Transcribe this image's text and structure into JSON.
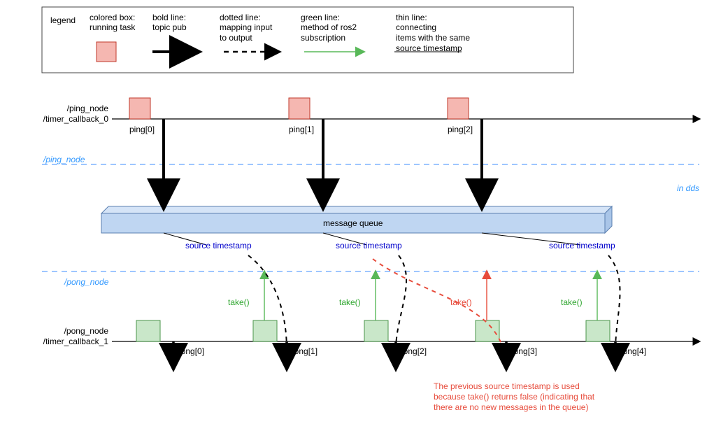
{
  "legend": {
    "title": "legend",
    "items": [
      {
        "title": "colored box:",
        "sub": "running task"
      },
      {
        "title": "bold line:",
        "sub": "topic pub"
      },
      {
        "title": "dotted line:",
        "sub": "mapping input\nto output"
      },
      {
        "title": "green line:",
        "sub": "method of ros2\nsubscription"
      },
      {
        "title": "thin line:",
        "sub": "connecting\nitems with the same\nsource timestamp"
      }
    ]
  },
  "ping_node_label": "/ping_node\n/timer_callback_0",
  "pong_node_label": "/pong_node\n/timer_callback_1",
  "region_ping": "/ping_node",
  "region_dds": "in dds",
  "region_pong": "/pong_node",
  "message_queue": "message queue",
  "source_ts": "source timestamp",
  "take_ok": "take()",
  "take_fail": "take()",
  "note_text": "The previous source timestamp is used\nbecause take() returns false (indicating that\nthere are no new messages in the queue)",
  "pings": [
    "ping[0]",
    "ping[1]",
    "ping[2]"
  ],
  "pongs": [
    "pong[0]",
    "pong[1]",
    "pong[2]",
    "pong[3]",
    "pong[4]"
  ],
  "chart_data": {
    "type": "timeline-diagram",
    "timelines": [
      {
        "name": "/ping_node/timer_callback_0",
        "events": [
          "ping[0]",
          "ping[1]",
          "ping[2]"
        ]
      },
      {
        "name": "/pong_node/timer_callback_1",
        "events": [
          "pong[0]",
          "pong[1]",
          "pong[2]",
          "pong[3]",
          "pong[4]"
        ]
      }
    ],
    "buffer": "message queue (in dds)",
    "mappings": [
      {
        "from": "ping[0]",
        "to": "pong[1]",
        "take": true
      },
      {
        "from": "ping[1]",
        "to": "pong[2]",
        "take": true
      },
      {
        "from": "ping[1]",
        "to": "pong[3]",
        "take": false,
        "reason": "take() returns false; previous source timestamp reused"
      },
      {
        "from": "ping[2]",
        "to": "pong[4]",
        "take": true
      }
    ],
    "legend": {
      "colored_box": "running task",
      "bold_line": "topic pub",
      "dotted_line": "mapping input to output",
      "green_line": "method of ros2 subscription",
      "thin_line": "connecting items with the same source timestamp"
    }
  }
}
